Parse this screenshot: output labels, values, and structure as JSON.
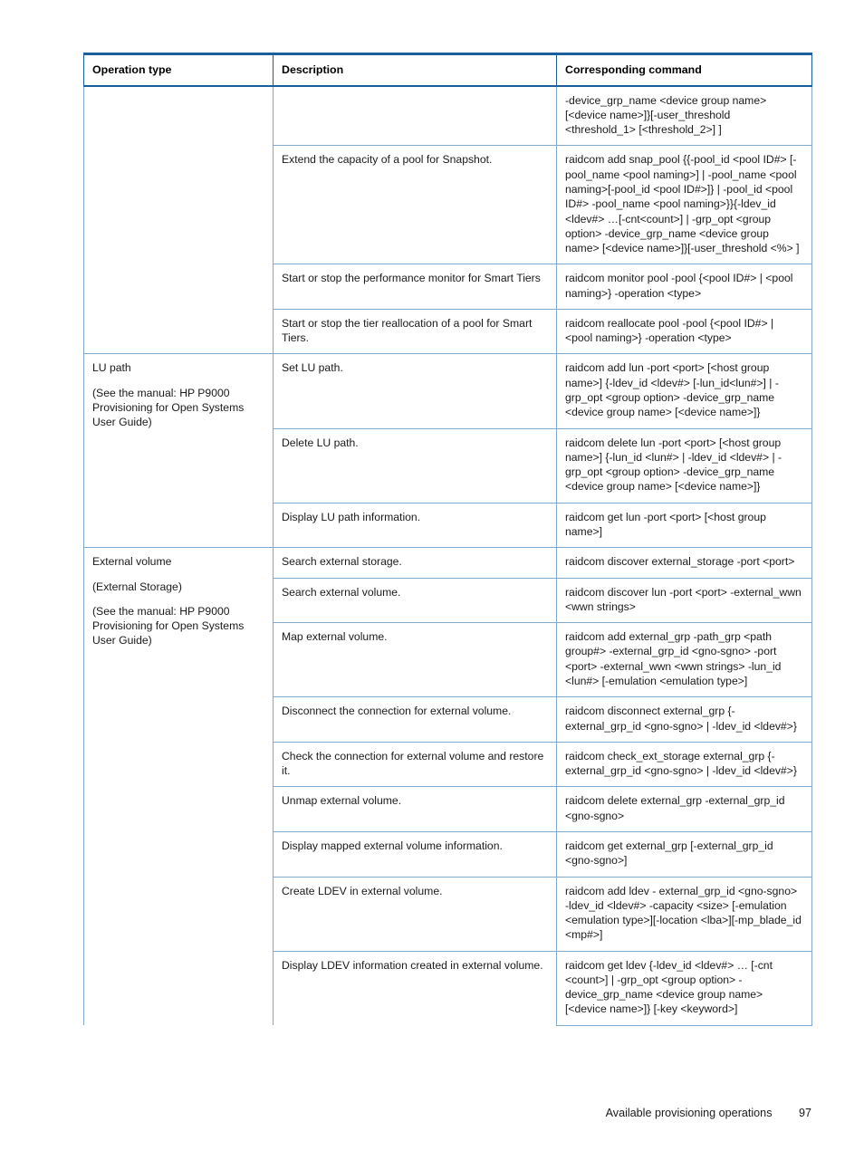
{
  "document": {
    "footer": {
      "section_title": "Available provisioning operations",
      "page_number": "97"
    }
  },
  "table": {
    "columns": [
      {
        "key": "operation_type",
        "label": "Operation type"
      },
      {
        "key": "description",
        "label": "Description"
      },
      {
        "key": "corresponding_command",
        "label": "Corresponding command"
      }
    ],
    "colors": {
      "header_rule": "#1b5e9e",
      "grid_line": "#7fa8cc",
      "text": "#1a1a1a"
    },
    "groups": [
      {
        "id": "continued-pool",
        "operation_type": {
          "lines": []
        },
        "rows": [
          {
            "id": "row-continued-threshold",
            "description": "",
            "command": "-device_grp_name <device group name> [<device name>]}[-user_threshold <threshold_1> [<threshold_2>] ]"
          },
          {
            "id": "row-extend-snap-pool",
            "description": "Extend the capacity of a pool for Snapshot.",
            "command": "raidcom add snap_pool {{-pool_id <pool ID#> [-pool_name <pool naming>] | -pool_name <pool naming>[-pool_id <pool ID#>]} | -pool_id <pool ID#> -pool_name <pool naming>}}{-ldev_id <ldev#> …[-cnt<count>] | -grp_opt <group option> -device_grp_name <device group name> [<device name>]}[-user_threshold <%> ]"
          },
          {
            "id": "row-monitor-pool",
            "description": "Start or stop the performance monitor for Smart Tiers",
            "command": "raidcom monitor pool -pool {<pool ID#> | <pool naming>} -operation <type>"
          },
          {
            "id": "row-reallocate-pool",
            "description": "Start or stop the tier reallocation of a pool for Smart Tiers.",
            "command": "raidcom reallocate pool -pool {<pool ID#> | <pool naming>} -operation <type>"
          }
        ]
      },
      {
        "id": "lu-path",
        "operation_type": {
          "lines": [
            "LU path",
            "(See the manual: HP P9000 Provisioning for Open Systems User Guide)"
          ]
        },
        "rows": [
          {
            "id": "row-set-lu-path",
            "description": "Set LU path.",
            "command": "raidcom add lun -port <port> [<host group name>] {-ldev_id <ldev#> [-lun_id<lun#>] | -grp_opt <group option> -device_grp_name <device group name> [<device name>]}"
          },
          {
            "id": "row-delete-lu-path",
            "description": "Delete LU path.",
            "command": "raidcom delete lun -port <port> [<host group name>] {-lun_id <lun#> | -ldev_id <ldev#> | -grp_opt <group option> -device_grp_name <device group name> [<device name>]}"
          },
          {
            "id": "row-display-lu-path",
            "description": "Display LU path information.",
            "command": "raidcom get lun -port <port> [<host group name>]"
          }
        ]
      },
      {
        "id": "external-volume",
        "operation_type": {
          "lines": [
            "External volume",
            "(External Storage)",
            "(See the manual: HP P9000 Provisioning for Open Systems User Guide)"
          ]
        },
        "rows": [
          {
            "id": "row-search-external-storage",
            "description": "Search external storage.",
            "command": "raidcom discover external_storage -port <port>"
          },
          {
            "id": "row-search-external-volume",
            "description": "Search external volume.",
            "command": "raidcom discover lun -port <port> -external_wwn <wwn strings>"
          },
          {
            "id": "row-map-external-volume",
            "description": "Map external volume.",
            "command": "raidcom add external_grp -path_grp <path group#> -external_grp_id <gno-sgno> -port <port> -external_wwn <wwn strings> -lun_id <lun#> [-emulation <emulation type>]"
          },
          {
            "id": "row-disconnect-external-volume",
            "description": "Disconnect the connection for external volume.",
            "command": "raidcom disconnect external_grp {-external_grp_id <gno-sgno> | -ldev_id <ldev#>}"
          },
          {
            "id": "row-check-external-volume",
            "description": "Check the connection for external volume and restore it.",
            "command": "raidcom check_ext_storage external_grp {-external_grp_id <gno-sgno> | -ldev_id <ldev#>}"
          },
          {
            "id": "row-unmap-external-volume",
            "description": "Unmap external volume.",
            "command": "raidcom delete external_grp -external_grp_id <gno-sgno>"
          },
          {
            "id": "row-display-mapped-external-volume",
            "description": "Display mapped external volume information.",
            "command": "raidcom get external_grp [-external_grp_id <gno-sgno>]"
          },
          {
            "id": "row-create-ldev-external-volume",
            "description": "Create LDEV in external volume.",
            "command": "raidcom add ldev - external_grp_id <gno-sgno> -ldev_id <ldev#> -capacity <size> [-emulation <emulation type>][-location <lba>][-mp_blade_id <mp#>]"
          },
          {
            "id": "row-display-ldev-external-volume",
            "description": "Display LDEV information created in external volume.",
            "command": "raidcom get ldev {-ldev_id <ldev#> … [-cnt <count>] | -grp_opt <group option> -device_grp_name <device group name> [<device name>]} [-key <keyword>]"
          }
        ]
      }
    ]
  }
}
